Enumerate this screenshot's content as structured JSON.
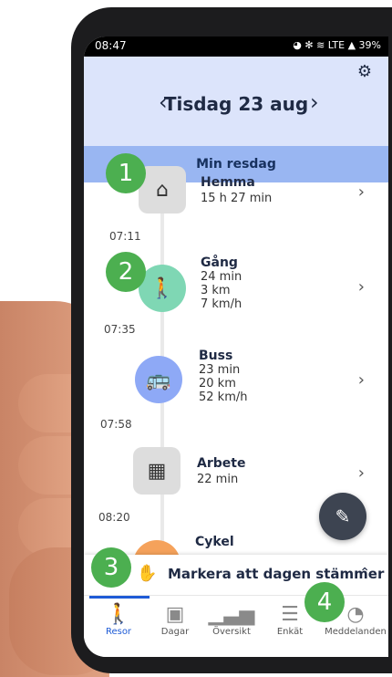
{
  "status": {
    "time": "08:47",
    "right": "◕ ✻ ≋ LTE ▲ 39%"
  },
  "header": {
    "title": "Tisdag 23 aug",
    "prev": "‹",
    "next": "›",
    "gear": "⚙"
  },
  "band": {
    "label": "Min resdag"
  },
  "times": [
    "07:11",
    "07:35",
    "07:58",
    "08:20"
  ],
  "items": [
    {
      "title": "Hemma",
      "lines": [
        "15 h 27 min"
      ]
    },
    {
      "title": "Gång",
      "lines": [
        "24 min",
        "3 km",
        "7 km/h"
      ]
    },
    {
      "title": "Buss",
      "lines": [
        "23 min",
        "20 km",
        "52 km/h"
      ]
    },
    {
      "title": "Arbete",
      "lines": [
        "22 min"
      ]
    },
    {
      "title": "Cykel",
      "lines": []
    }
  ],
  "badges": [
    "1",
    "2",
    "3",
    "4"
  ],
  "confirm": {
    "text": "Markera att dagen stämmer",
    "emoji": "✋",
    "caret": "⌃"
  },
  "nav": [
    {
      "label": "Resor",
      "icon": "walk-icon",
      "glyph": "🚶"
    },
    {
      "label": "Dagar",
      "icon": "calendar-icon",
      "glyph": "▣"
    },
    {
      "label": "Översikt",
      "icon": "bar-chart-icon",
      "glyph": "▁▃▅"
    },
    {
      "label": "Enkät",
      "icon": "clipboard-icon",
      "glyph": "☰"
    },
    {
      "label": "Meddelanden",
      "icon": "chat-icon",
      "glyph": "◔"
    }
  ],
  "colors": {
    "primary": "#1e5bd6",
    "header_bg": "#dce4fb",
    "band_bg": "#99b6f2",
    "badge": "#4caf50",
    "walk": "#7fd7b4",
    "bus": "#8ea9f6",
    "bike": "#f5a25b"
  }
}
